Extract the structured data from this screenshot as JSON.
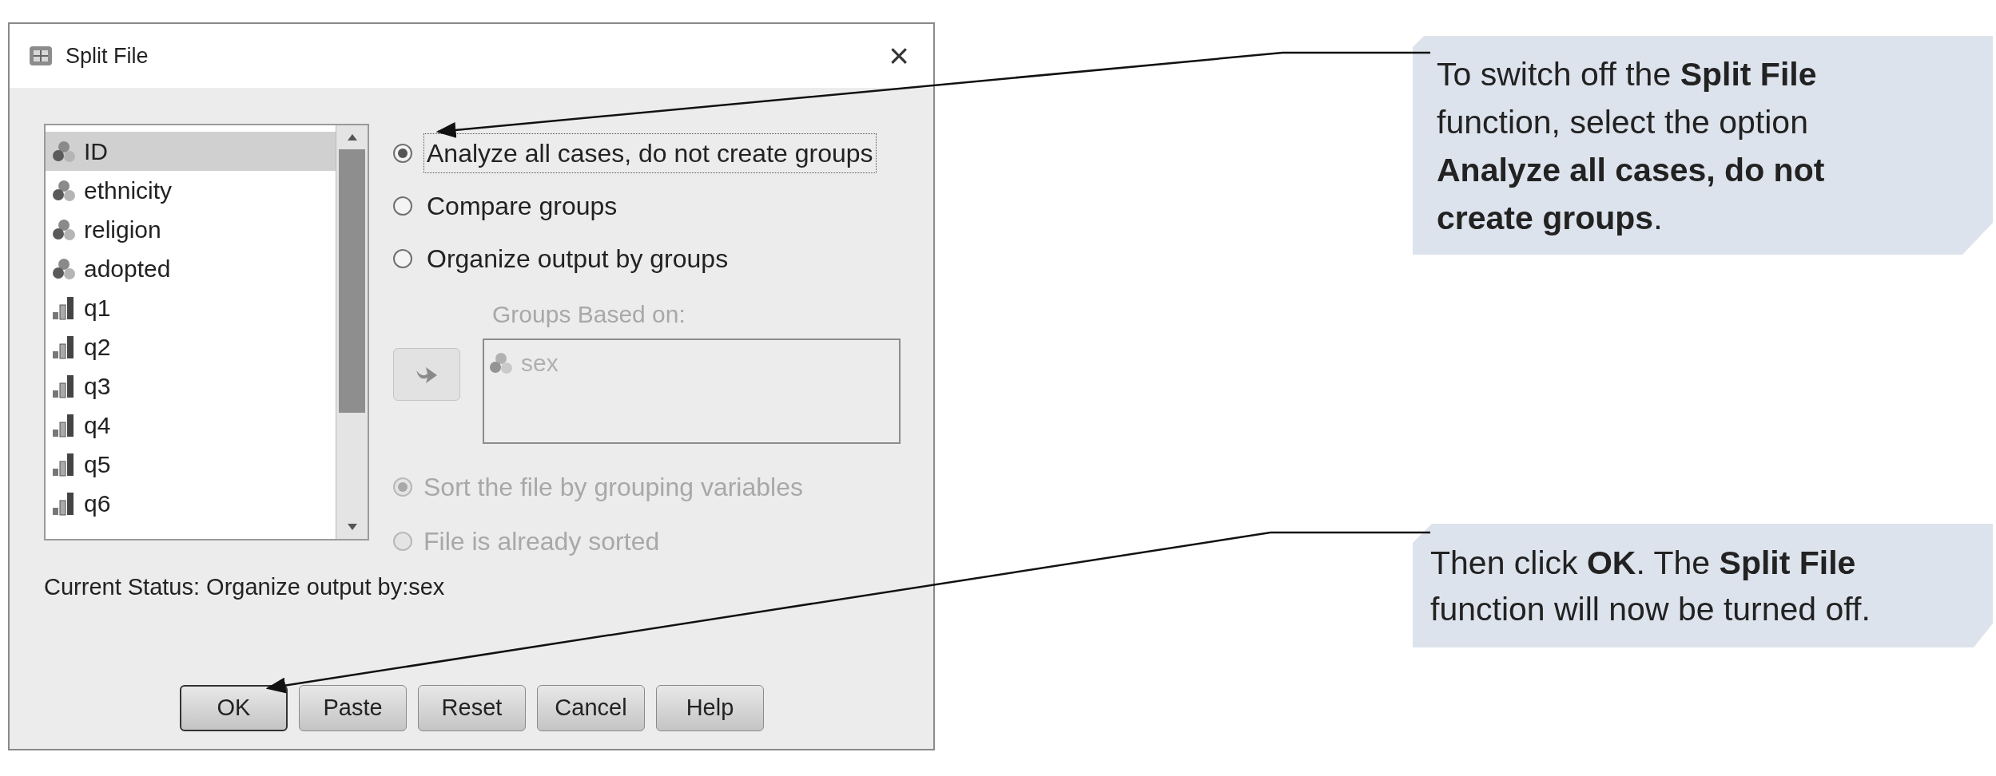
{
  "dialog": {
    "title": "Split File",
    "close": "×",
    "variables": [
      {
        "kind": "nominal",
        "name": "ID",
        "selected": true
      },
      {
        "kind": "nominal",
        "name": "ethnicity",
        "selected": false
      },
      {
        "kind": "nominal",
        "name": "religion",
        "selected": false
      },
      {
        "kind": "nominal",
        "name": "adopted",
        "selected": false
      },
      {
        "kind": "scale",
        "name": "q1",
        "selected": false
      },
      {
        "kind": "scale",
        "name": "q2",
        "selected": false
      },
      {
        "kind": "scale",
        "name": "q3",
        "selected": false
      },
      {
        "kind": "scale",
        "name": "q4",
        "selected": false
      },
      {
        "kind": "scale",
        "name": "q5",
        "selected": false
      },
      {
        "kind": "scale",
        "name": "q6",
        "selected": false
      }
    ],
    "modes": [
      {
        "label": "Analyze all cases, do not create groups",
        "selected": true
      },
      {
        "label": "Compare groups",
        "selected": false
      },
      {
        "label": "Organize output by groups",
        "selected": false
      }
    ],
    "groups_label": "Groups Based on:",
    "groups": [
      {
        "kind": "nominal",
        "name": "sex"
      }
    ],
    "sort_options": [
      {
        "label": "Sort the file by grouping variables",
        "selected": true,
        "disabled": true
      },
      {
        "label": "File is already sorted",
        "selected": false,
        "disabled": true
      }
    ],
    "status": "Current Status: Organize output by:sex",
    "buttons": [
      {
        "label": "OK",
        "default": true
      },
      {
        "label": "Paste",
        "default": false
      },
      {
        "label": "Reset",
        "default": false
      },
      {
        "label": "Cancel",
        "default": false
      },
      {
        "label": "Help",
        "default": false
      }
    ]
  },
  "callouts": [
    {
      "text": "To switch off the **Split File** function, select the option **Analyze all cases, do not create groups**."
    },
    {
      "text": "Then click **OK**. The **Split File** function will now be turned off."
    }
  ]
}
